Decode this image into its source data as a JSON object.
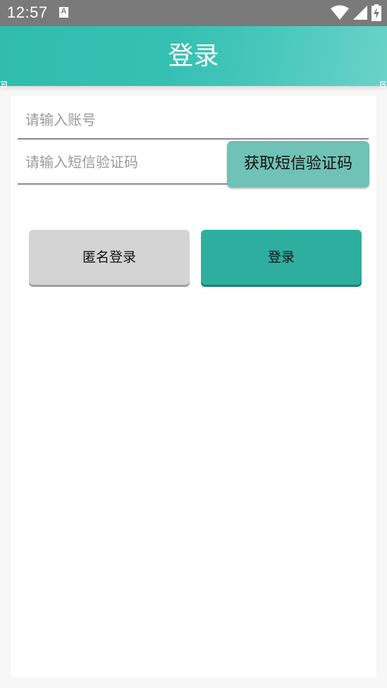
{
  "status_bar": {
    "time": "12:57",
    "notification_icon_letter": "A",
    "icons": [
      "wifi-icon",
      "signal-icon",
      "battery-charging-icon"
    ]
  },
  "header": {
    "title": "登录",
    "background_color": "#36c0b3"
  },
  "form": {
    "account_placeholder": "请输入账号",
    "account_value": "",
    "code_placeholder": "请输入短信验证码",
    "code_value": "",
    "get_code_label": "获取短信验证码"
  },
  "buttons": {
    "anonymous_login_label": "匿名登录",
    "login_label": "登录",
    "login_color": "#2dae9f",
    "anonymous_color": "#d4d4d4",
    "sms_button_color": "#70c1b6"
  }
}
